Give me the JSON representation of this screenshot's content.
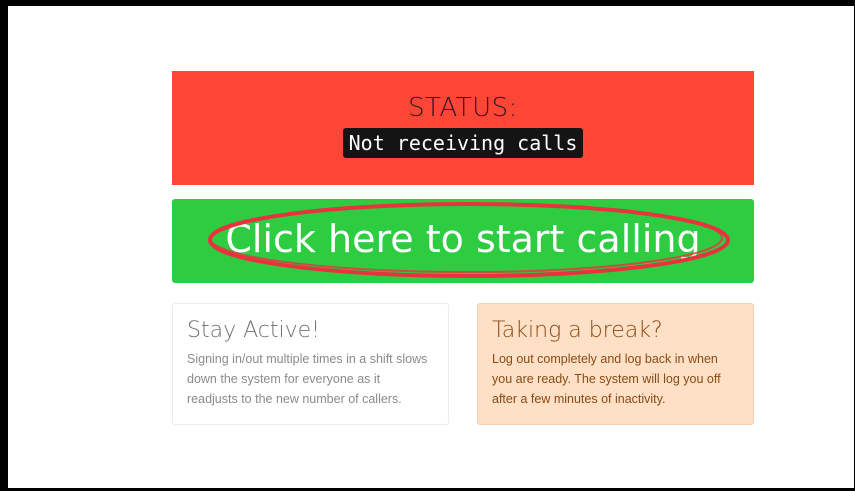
{
  "status": {
    "heading": "STATUS:",
    "value": "Not receiving calls"
  },
  "call_button": {
    "label": "Click here to start calling"
  },
  "cards": [
    {
      "title": "Stay Active!",
      "text": "Signing in/out multiple times in a shift slows down the system for everyone as it readjusts to the new number of callers."
    },
    {
      "title": "Taking a break?",
      "text": "Log out completely and log back in when you are ready. The system will log you off after a few minutes of inactivity."
    }
  ],
  "colors": {
    "status_bg": "#ff4535",
    "call_button_bg": "#2ecc40",
    "annotation": "#e8333f",
    "break_card_bg": "#fde0c6",
    "break_card_text": "#8a4a14"
  }
}
